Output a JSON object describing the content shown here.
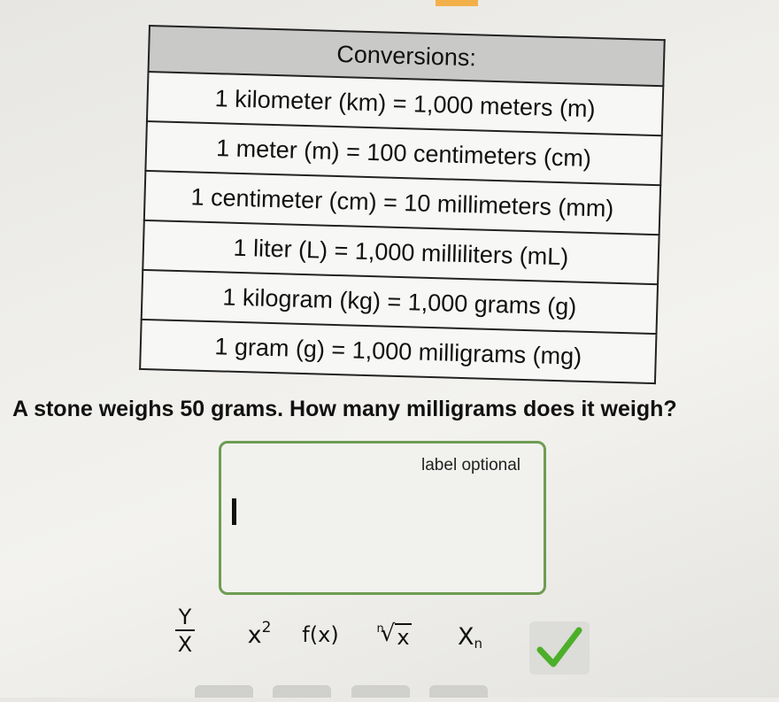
{
  "table": {
    "header": "Conversions:",
    "rows": [
      "1 kilometer (km) = 1,000 meters (m)",
      "1 meter (m) = 100 centimeters (cm)",
      "1 centimeter (cm) = 10 millimeters (mm)",
      "1 liter (L) = 1,000 milliliters (mL)",
      "1 kilogram (kg) = 1,000 grams (g)",
      "1 gram (g) = 1,000 milligrams (mg)"
    ]
  },
  "question": "A stone weighs 50 grams. How many milligrams does it weigh?",
  "answer": {
    "label_placeholder": "label optional",
    "value": ""
  },
  "toolbar": {
    "fraction_num": "Y",
    "fraction_den": "X",
    "power_base": "x",
    "power_exp": "2",
    "function": "f(x)",
    "root_index": "n",
    "root_radicand": "x",
    "subscript_base": "X",
    "subscript_index": "n"
  },
  "colors": {
    "accent_green": "#6d9c52",
    "check_green": "#4caf2a"
  },
  "icons": {
    "submit": "checkmark-icon",
    "fraction": "fraction-icon",
    "root": "nth-root-icon"
  }
}
